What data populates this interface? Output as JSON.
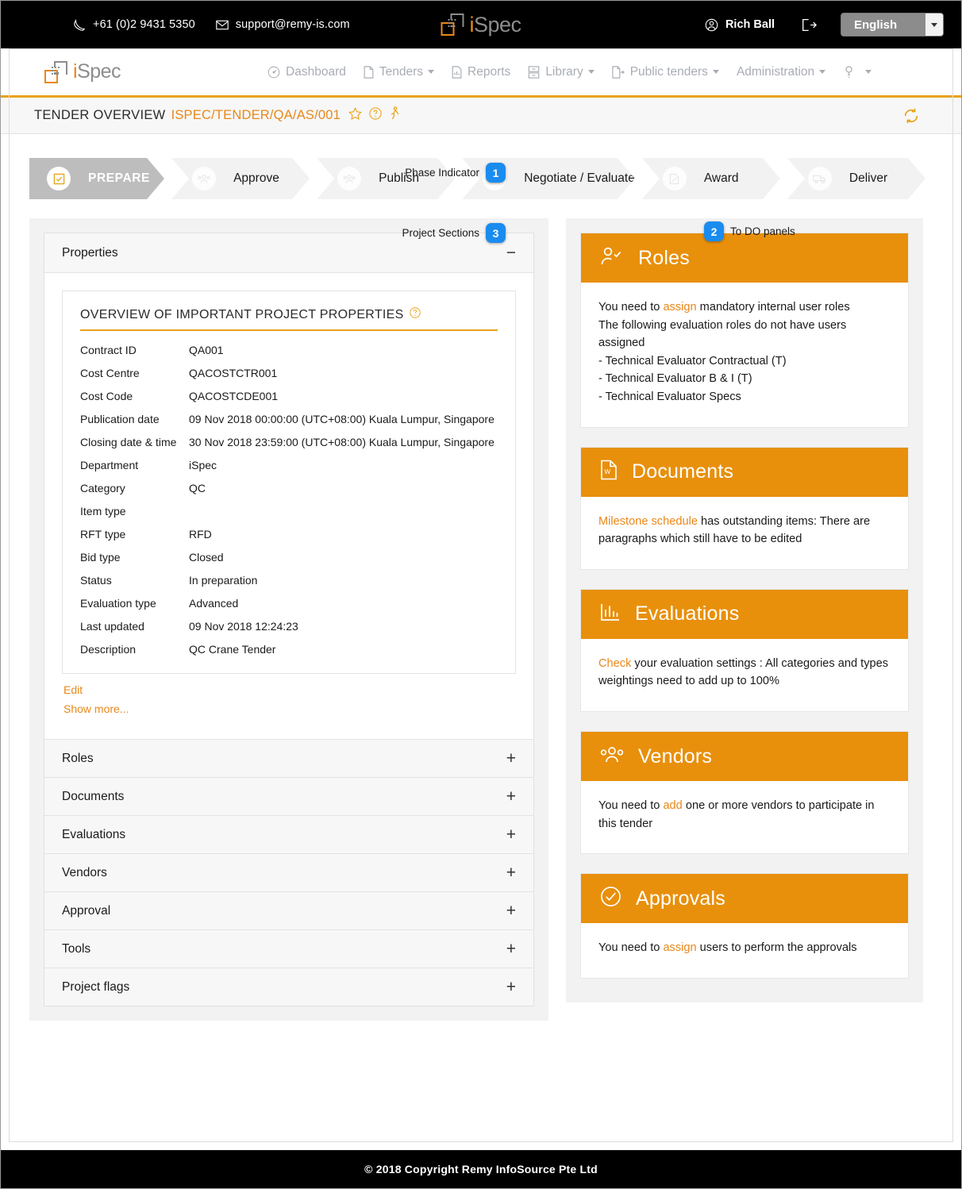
{
  "topbar": {
    "phone": "+61 (0)2 9431 5350",
    "email": "support@remy-is.com",
    "phone_icon": "phone-icon",
    "email_icon": "envelope-icon",
    "brand": "iSpec",
    "brand_i": "i",
    "brand_spec": "Spec",
    "user_name": "Rich Ball",
    "user_icon": "user-circle-icon",
    "logout_icon": "logout-icon",
    "language": "English"
  },
  "nav": {
    "items": [
      {
        "label": "Dashboard",
        "icon": "dashboard-gauge-icon",
        "caret": false
      },
      {
        "label": "Tenders",
        "icon": "document-icon",
        "caret": true
      },
      {
        "label": "Reports",
        "icon": "report-chart-icon",
        "caret": false
      },
      {
        "label": "Library",
        "icon": "library-drawer-icon",
        "caret": true
      },
      {
        "label": "Public tenders",
        "icon": "document-arrow-icon",
        "caret": true
      },
      {
        "label": "Administration",
        "icon": "",
        "caret": true
      },
      {
        "label": "",
        "icon": "help-question-icon",
        "caret": true
      }
    ]
  },
  "tender_header": {
    "title": "TENDER OVERVIEW",
    "code": "ISPEC/TENDER/QA/AS/001",
    "star_icon": "star-outline-icon",
    "help_icon": "question-circle-icon",
    "walker_icon": "walking-person-icon",
    "refresh_icon": "refresh-sync-icon"
  },
  "annotations": {
    "phase_indicator": {
      "label": "Phase Indicator",
      "number": "1"
    },
    "project_sections": {
      "label": "Project Sections",
      "number": "3"
    },
    "todo_panels": {
      "label": "To DO panels",
      "number": "2"
    }
  },
  "phases": [
    {
      "label": "PREPARE",
      "icon": "checkbox-icon",
      "active": true
    },
    {
      "label": "Approve",
      "icon": "people-icon",
      "active": false
    },
    {
      "label": "Publish",
      "icon": "people-icon",
      "active": false
    },
    {
      "label": "Negotiate / Evaluate",
      "icon": "chart-icon",
      "active": false
    },
    {
      "label": "Award",
      "icon": "signed-document-icon",
      "active": false
    },
    {
      "label": "Deliver",
      "icon": "truck-icon",
      "active": false
    }
  ],
  "properties_section": {
    "header": "Properties",
    "collapse_sign": "−",
    "box_title": "OVERVIEW OF IMPORTANT PROJECT PROPERTIES",
    "box_title_icon": "question-circle-icon",
    "rows": [
      {
        "key": "Contract ID",
        "value": "QA001"
      },
      {
        "key": "Cost Centre",
        "value": "QACOSTCTR001"
      },
      {
        "key": "Cost Code",
        "value": "QACOSTCDE001"
      },
      {
        "key": "Publication date",
        "value": "09 Nov 2018 00:00:00 (UTC+08:00) Kuala Lumpur, Singapore"
      },
      {
        "key": "Closing date & time",
        "value": "30 Nov 2018 23:59:00 (UTC+08:00) Kuala Lumpur, Singapore"
      },
      {
        "key": "Department",
        "value": "iSpec"
      },
      {
        "key": "Category",
        "value": "QC"
      },
      {
        "key": "Item type",
        "value": ""
      },
      {
        "key": "RFT type",
        "value": "RFD"
      },
      {
        "key": "Bid type",
        "value": "Closed"
      },
      {
        "key": "Status",
        "value": "In preparation"
      },
      {
        "key": "Evaluation type",
        "value": "Advanced"
      },
      {
        "key": "Last updated",
        "value": "09 Nov 2018 12:24:23"
      },
      {
        "key": "Description",
        "value": "QC Crane Tender"
      }
    ],
    "edit_link": "Edit",
    "show_more_link": "Show more..."
  },
  "collapsed_sections": [
    {
      "label": "Roles",
      "sign": "+"
    },
    {
      "label": "Documents",
      "sign": "+"
    },
    {
      "label": "Evaluations",
      "sign": "+"
    },
    {
      "label": "Vendors",
      "sign": "+"
    },
    {
      "label": "Approval",
      "sign": "+"
    },
    {
      "label": "Tools",
      "sign": "+"
    },
    {
      "label": "Project flags",
      "sign": "+"
    }
  ],
  "todo_panels": [
    {
      "title": "Roles",
      "icon": "user-check-icon",
      "lines": [
        {
          "pre": "You need to ",
          "link": "assign",
          "post": " mandatory internal user roles"
        },
        {
          "pre": "The following evaluation roles do not have users assigned",
          "link": "",
          "post": ""
        }
      ],
      "bullets": [
        "- Technical Evaluator Contractual (T)",
        "- Technical Evaluator B & I (T)",
        "- Technical Evaluator Specs"
      ]
    },
    {
      "title": "Documents",
      "icon": "word-document-icon",
      "lines": [
        {
          "pre": "",
          "link": "Milestone schedule",
          "post": " has outstanding items: There are paragraphs which still have to be edited"
        }
      ],
      "bullets": []
    },
    {
      "title": "Evaluations",
      "icon": "bar-chart-icon",
      "lines": [
        {
          "pre": "",
          "link": "Check",
          "post": " your evaluation settings : All categories and types weightings need to add up to 100%"
        }
      ],
      "bullets": []
    },
    {
      "title": "Vendors",
      "icon": "people-group-icon",
      "lines": [
        {
          "pre": "You need to ",
          "link": "add",
          "post": " one or more vendors to participate in this tender"
        }
      ],
      "bullets": []
    },
    {
      "title": "Approvals",
      "icon": "check-circle-icon",
      "lines": [
        {
          "pre": "You need to ",
          "link": "assign",
          "post": " users to perform the approvals"
        }
      ],
      "bullets": []
    }
  ],
  "footer": {
    "text": "© 2018 Copyright  Remy InfoSource Pte Ltd"
  },
  "colors": {
    "accent_orange": "#e8881a",
    "panel_header_orange": "#e8900c",
    "badge_blue": "#1a8cf0",
    "active_phase_gray": "#bdbdbd"
  }
}
